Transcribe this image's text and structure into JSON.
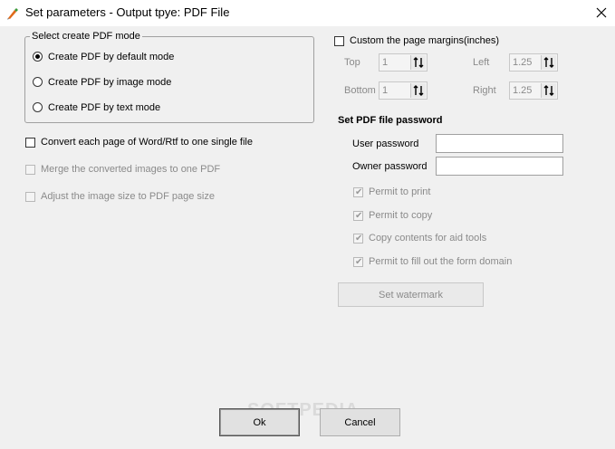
{
  "window": {
    "title": "Set parameters - Output tpye: PDF File",
    "close_icon": "close-icon"
  },
  "mode_group": {
    "legend": "Select create PDF mode",
    "options": [
      {
        "label": "Create PDF by default mode",
        "checked": true
      },
      {
        "label": "Create PDF by image mode",
        "checked": false
      },
      {
        "label": "Create PDF by text mode",
        "checked": false
      }
    ]
  },
  "left_options": [
    {
      "label": "Convert each page of Word/Rtf to one single file",
      "enabled": true,
      "checked": false
    },
    {
      "label": "Merge the converted images to one PDF",
      "enabled": false,
      "checked": false
    },
    {
      "label": "Adjust the image size to PDF page size",
      "enabled": false,
      "checked": false
    }
  ],
  "margins": {
    "label": "Custom the page margins(inches)",
    "checked": false,
    "top": {
      "label": "Top",
      "value": "1"
    },
    "left": {
      "label": "Left",
      "value": "1.25"
    },
    "bottom": {
      "label": "Bottom",
      "value": "1"
    },
    "right": {
      "label": "Right",
      "value": "1.25"
    }
  },
  "password": {
    "heading": "Set PDF file password",
    "user_label": "User password",
    "user_value": "",
    "owner_label": "Owner password",
    "owner_value": "",
    "permissions": [
      {
        "label": "Permit to print",
        "checked": true
      },
      {
        "label": "Permit to copy",
        "checked": true
      },
      {
        "label": "Copy contents for aid tools",
        "checked": true
      },
      {
        "label": "Permit to fill out the form domain",
        "checked": true
      }
    ]
  },
  "buttons": {
    "watermark": "Set watermark",
    "ok": "Ok",
    "cancel": "Cancel"
  },
  "watermark_text": "SOFTPEDIA"
}
